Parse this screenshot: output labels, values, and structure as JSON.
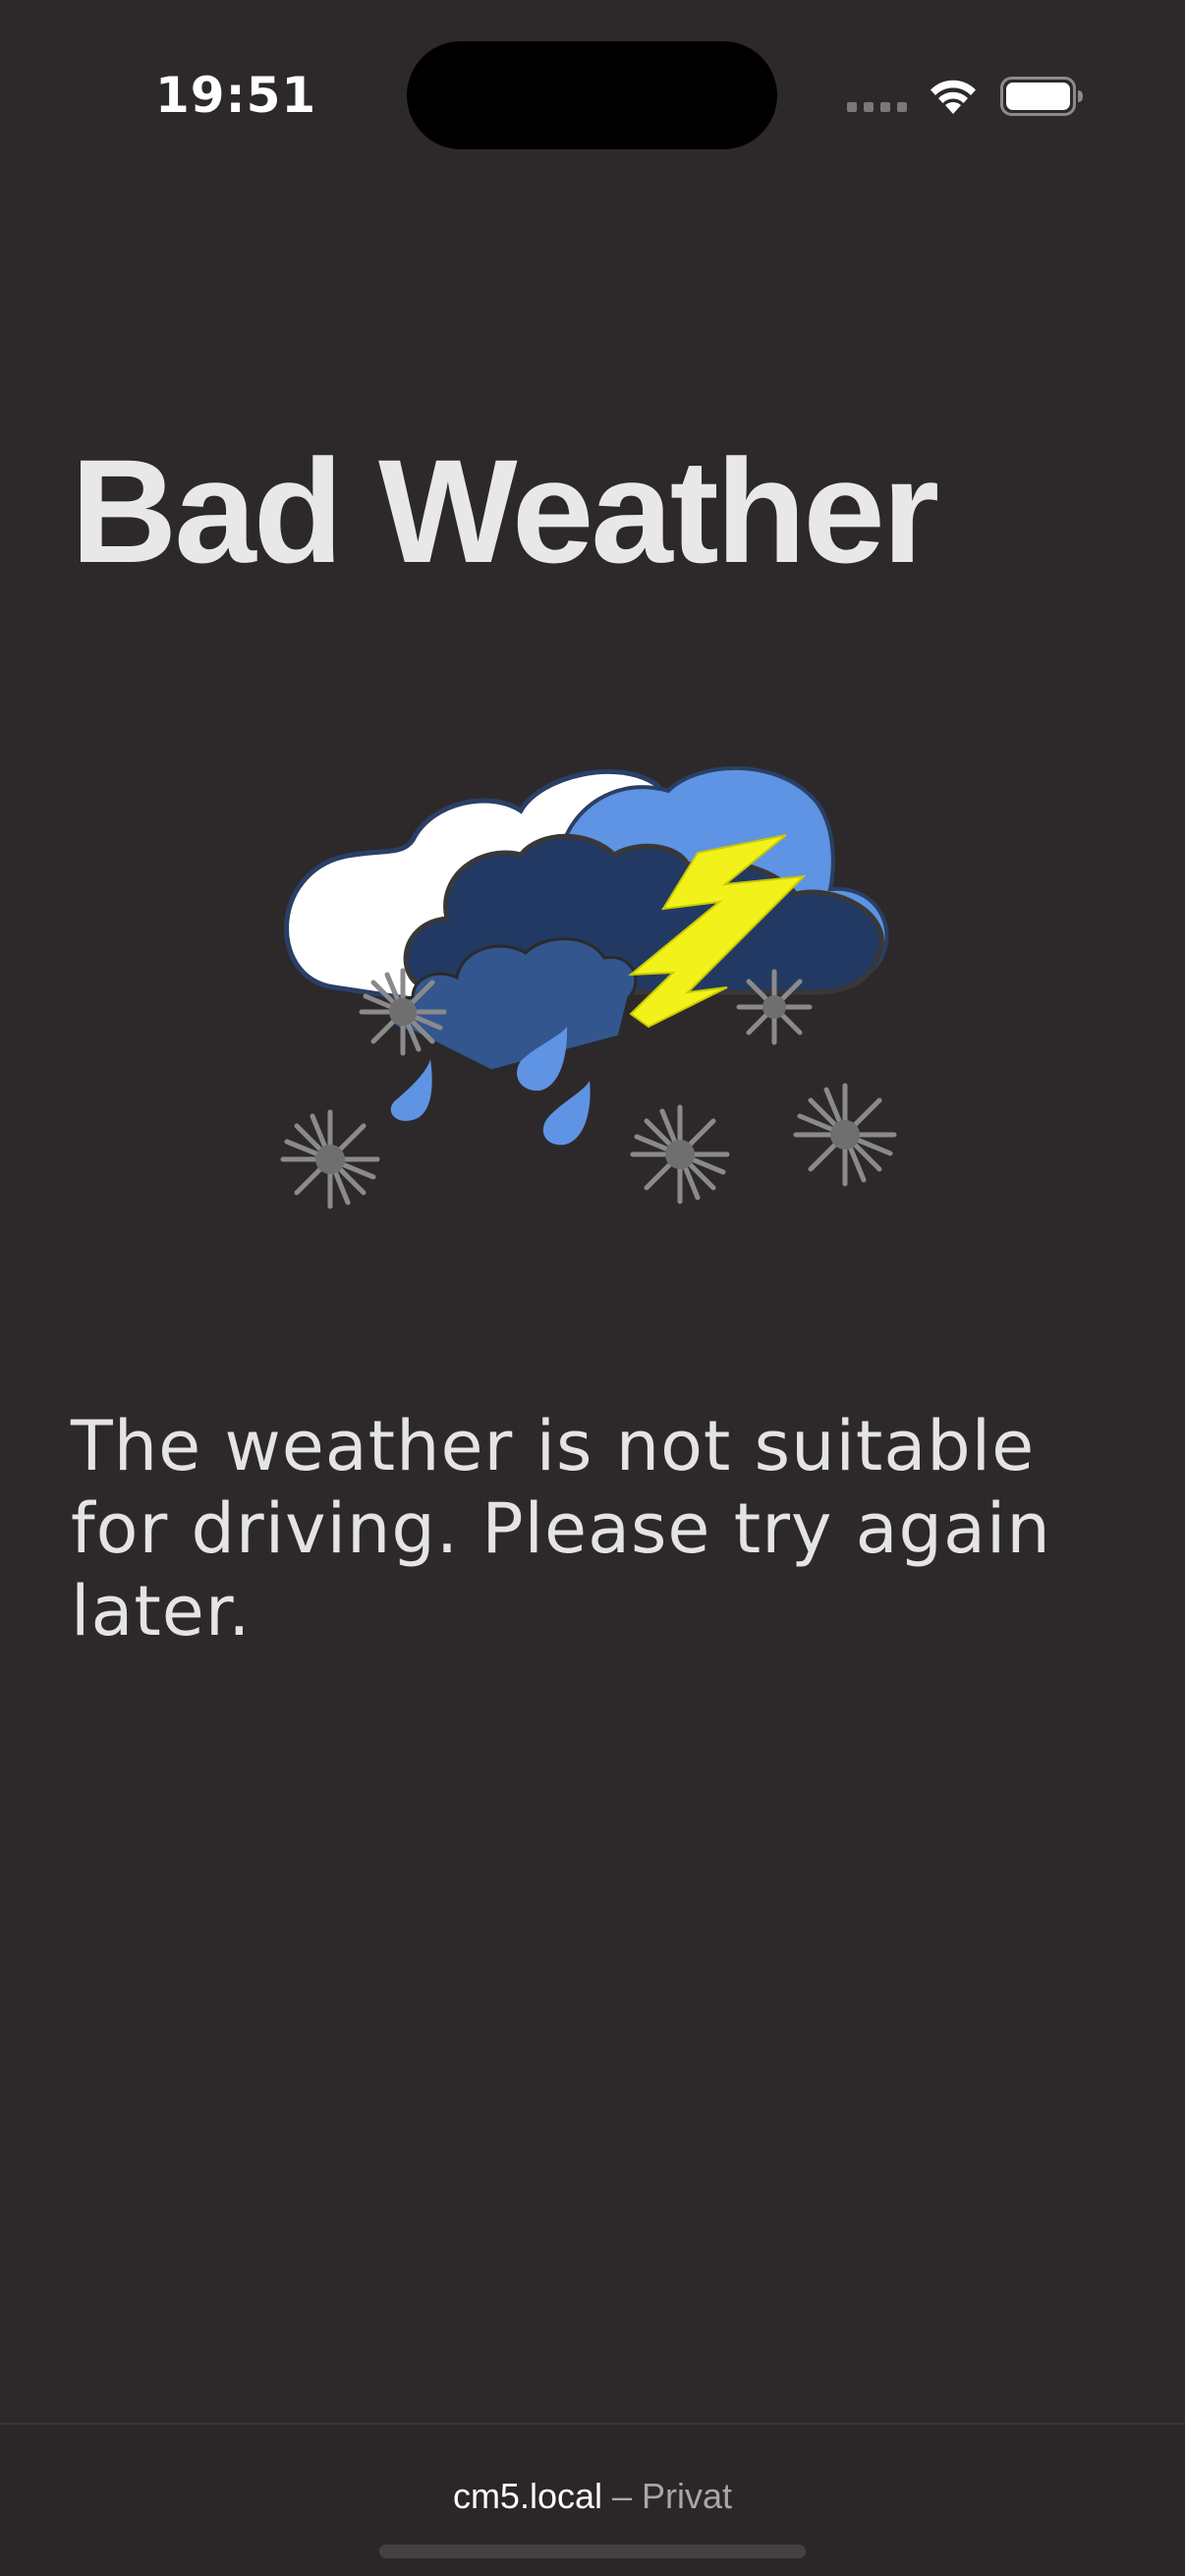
{
  "status_bar": {
    "time": "19:51",
    "icons": [
      "signal-dots-icon",
      "wifi-icon",
      "battery-icon"
    ]
  },
  "page": {
    "title": "Bad Weather",
    "image": "thunderstorm-weather-icon",
    "message": "The weather is not suitable for driving. Please try again later."
  },
  "browser_bar": {
    "host": "cm5.local",
    "separator": " – ",
    "mode": "Privat"
  },
  "colors": {
    "background": "#2d292a",
    "text": "#e8e8e8",
    "cloud_white": "#ffffff",
    "cloud_light_blue": "#5f93e3",
    "cloud_dark_blue": "#223a63",
    "cloud_mid_blue": "#34568f",
    "lightning": "#f2f21a",
    "rain": "#5f93e3",
    "snowflake": "#8a8a8a"
  }
}
